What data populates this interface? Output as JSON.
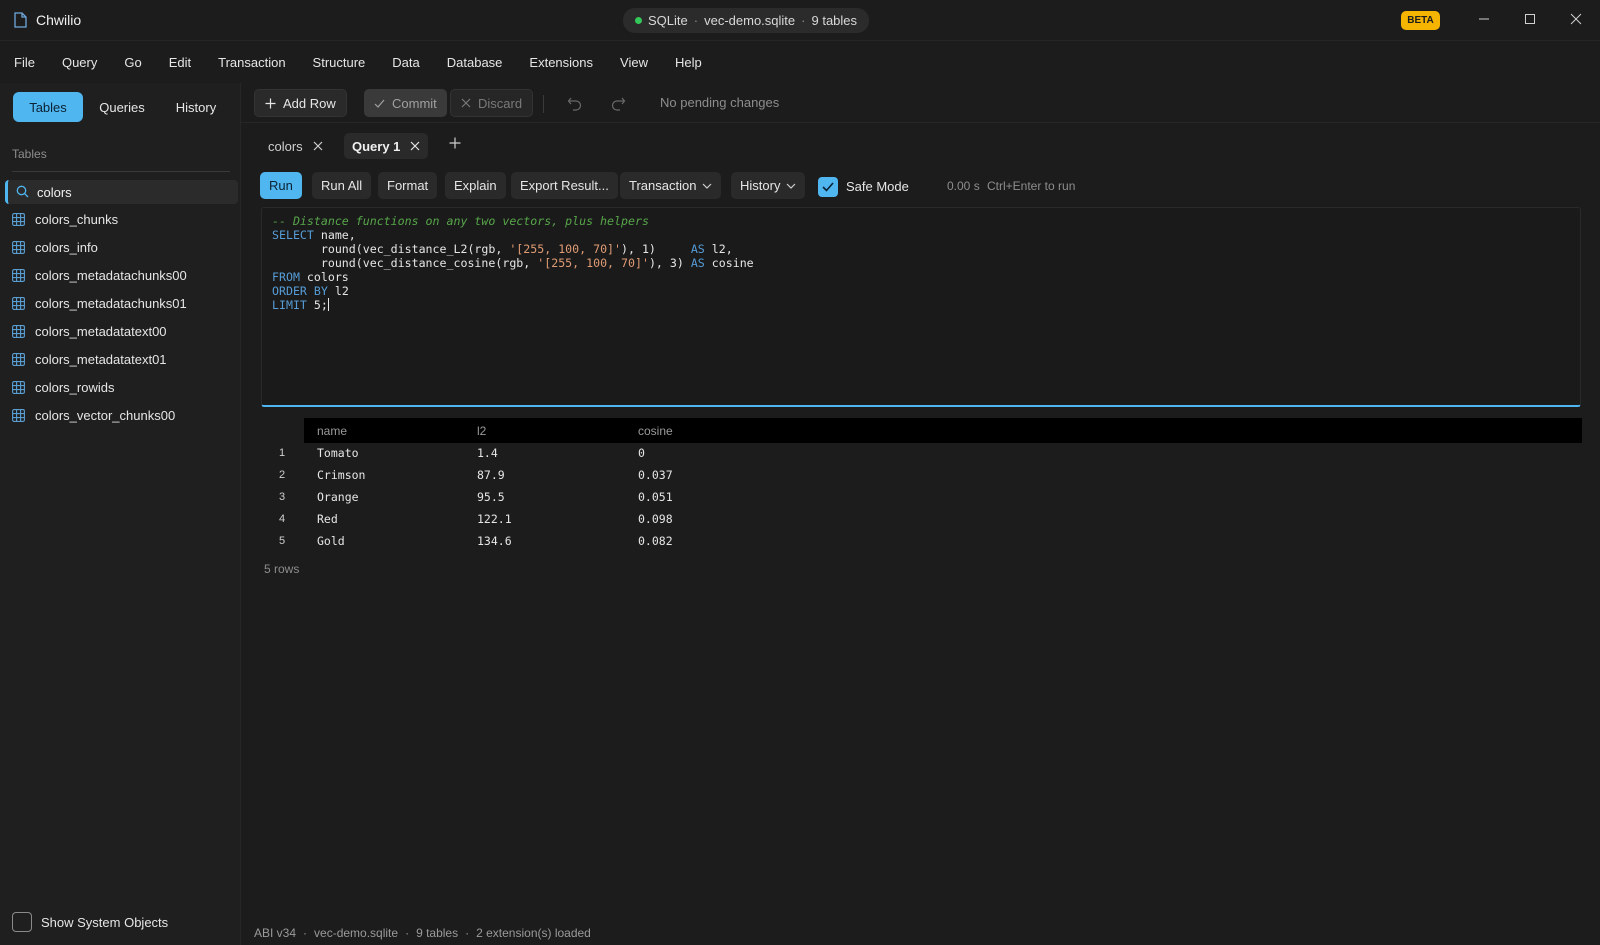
{
  "titlebar": {
    "app_title": "Chwilio",
    "connection": {
      "engine": "SQLite",
      "file": "vec-demo.sqlite",
      "tables": "9 tables",
      "separator": "·"
    },
    "beta_badge": "BETA"
  },
  "menu": [
    "File",
    "Query",
    "Go",
    "Edit",
    "Transaction",
    "Structure",
    "Data",
    "Database",
    "Extensions",
    "View",
    "Help"
  ],
  "sidebar": {
    "segments": [
      "Tables",
      "Queries",
      "History"
    ],
    "active_segment": "Tables",
    "section_label": "Tables",
    "search_value": "colors",
    "tables": [
      "colors_chunks",
      "colors_info",
      "colors_metadatachunks00",
      "colors_metadatachunks01",
      "colors_metadatatext00",
      "colors_metadatatext01",
      "colors_rowids",
      "colors_vector_chunks00"
    ],
    "show_system_objects": "Show System Objects"
  },
  "toolbar": {
    "add_row": "Add Row",
    "commit": "Commit",
    "discard": "Discard",
    "pending": "No pending changes"
  },
  "tabs": [
    {
      "label": "colors"
    },
    {
      "label": "Query 1"
    }
  ],
  "query_toolbar": {
    "run": "Run",
    "run_all": "Run All",
    "format": "Format",
    "explain": "Explain",
    "export": "Export Result...",
    "transaction": "Transaction",
    "history": "History",
    "safe_mode": "Safe Mode",
    "timing": "0.00 s",
    "hint": "Ctrl+Enter to run"
  },
  "editor": {
    "lines": [
      "-- Distance functions on any two vectors, plus helpers",
      "SELECT name,",
      "       round(vec_distance_L2(rgb, '[255, 100, 70]'), 1)     AS l2,",
      "       round(vec_distance_cosine(rgb, '[255, 100, 70]'), 3) AS cosine",
      "FROM colors",
      "ORDER BY l2",
      "LIMIT 5;"
    ]
  },
  "results": {
    "columns": [
      "name",
      "l2",
      "cosine"
    ],
    "rows": [
      {
        "n": "1",
        "name": "Tomato",
        "l2": "1.4",
        "cosine": "0"
      },
      {
        "n": "2",
        "name": "Crimson",
        "l2": "87.9",
        "cosine": "0.037"
      },
      {
        "n": "3",
        "name": "Orange",
        "l2": "95.5",
        "cosine": "0.051"
      },
      {
        "n": "4",
        "name": "Red",
        "l2": "122.1",
        "cosine": "0.098"
      },
      {
        "n": "5",
        "name": "Gold",
        "l2": "134.6",
        "cosine": "0.082"
      }
    ],
    "row_count": "5 rows"
  },
  "statusbar": {
    "abi": "ABI v34",
    "file": "vec-demo.sqlite",
    "tables": "9 tables",
    "extensions": "2 extension(s) loaded",
    "separator": "·"
  },
  "colors": {
    "accent": "#4fb6f0",
    "beta": "#f5b400",
    "connected": "#34c759"
  }
}
